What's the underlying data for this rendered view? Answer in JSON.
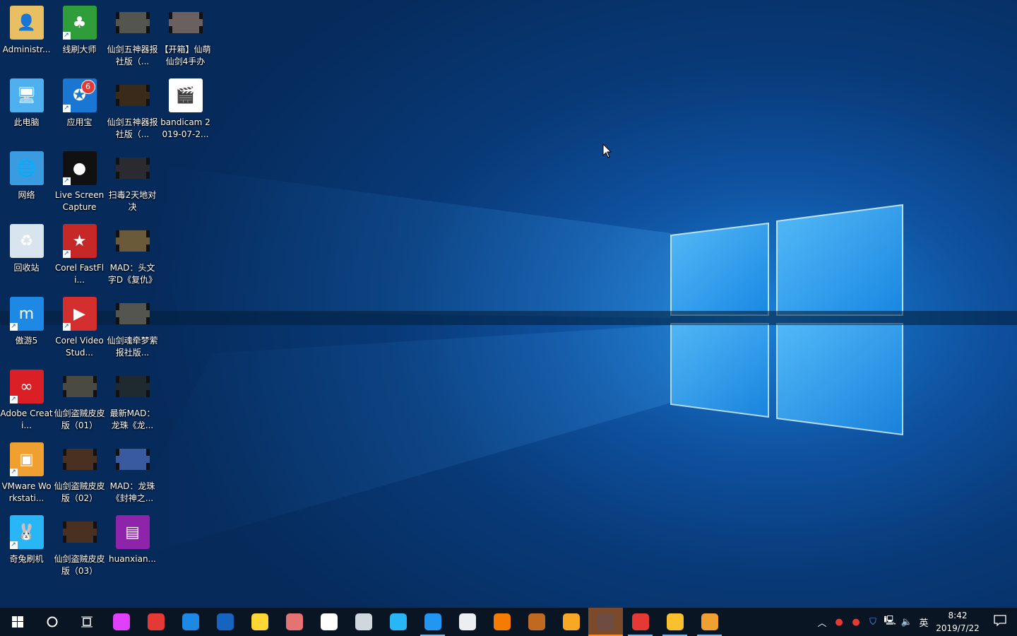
{
  "desktop": {
    "icons": [
      {
        "label": "Administr...",
        "icon": "user-folder-icon",
        "color": "#e8c063",
        "col": 0,
        "row": 0,
        "shortcut": false
      },
      {
        "label": "此电脑",
        "icon": "computer-icon",
        "color": "#4fb0f0",
        "col": 0,
        "row": 1,
        "shortcut": false
      },
      {
        "label": "网络",
        "icon": "network-icon",
        "color": "#3b9be0",
        "col": 0,
        "row": 2,
        "shortcut": false
      },
      {
        "label": "回收站",
        "icon": "recycle-bin-icon",
        "color": "#d8e4ee",
        "col": 0,
        "row": 3,
        "shortcut": false
      },
      {
        "label": "傲游5",
        "icon": "maxthon-icon",
        "color": "#1e88e5",
        "col": 0,
        "row": 4,
        "shortcut": true
      },
      {
        "label": "Adobe Creati...",
        "icon": "adobe-cc-icon",
        "color": "#da1f26",
        "col": 0,
        "row": 5,
        "shortcut": true
      },
      {
        "label": "VMware Workstati...",
        "icon": "vmware-icon",
        "color": "#f0a030",
        "col": 0,
        "row": 6,
        "shortcut": true
      },
      {
        "label": "奇兔刷机",
        "icon": "rabbit-icon",
        "color": "#29b6f6",
        "col": 0,
        "row": 7,
        "shortcut": true
      },
      {
        "label": "线刷大师",
        "icon": "flash-master-icon",
        "color": "#2e9d3a",
        "col": 1,
        "row": 0,
        "shortcut": true
      },
      {
        "label": "应用宝",
        "icon": "app-store-icon",
        "color": "#1976d2",
        "col": 1,
        "row": 1,
        "shortcut": true,
        "badge": "6"
      },
      {
        "label": "Live Screen Capture",
        "icon": "record-icon",
        "color": "#111111",
        "col": 1,
        "row": 2,
        "shortcut": true
      },
      {
        "label": "Corel FastFli...",
        "icon": "corel-fastflick-icon",
        "color": "#c62828",
        "col": 1,
        "row": 3,
        "shortcut": true
      },
      {
        "label": "Corel VideoStud...",
        "icon": "corel-videostudio-icon",
        "color": "#d32f2f",
        "col": 1,
        "row": 4,
        "shortcut": true
      },
      {
        "label": "仙剑盗贼皮皮版（01）",
        "icon": "video-file-icon",
        "color": "#4a4a42",
        "col": 1,
        "row": 5,
        "shortcut": false
      },
      {
        "label": "仙剑盗贼皮皮版（02）",
        "icon": "video-file-icon",
        "color": "#4a3020",
        "col": 1,
        "row": 6,
        "shortcut": false
      },
      {
        "label": "仙剑盗贼皮皮版（03）",
        "icon": "video-file-icon",
        "color": "#4a3020",
        "col": 1,
        "row": 7,
        "shortcut": false
      },
      {
        "label": "仙剑五神器报社版（...",
        "icon": "video-file-icon",
        "color": "#555550",
        "col": 2,
        "row": 0,
        "shortcut": false
      },
      {
        "label": "仙剑五神器报社版（...",
        "icon": "video-file-icon",
        "color": "#3a2a1a",
        "col": 2,
        "row": 1,
        "shortcut": false
      },
      {
        "label": "扫毒2天地对决",
        "icon": "video-file-icon",
        "color": "#2a2a30",
        "col": 2,
        "row": 2,
        "shortcut": false
      },
      {
        "label": "MAD：头文字D《复仇》",
        "icon": "video-file-icon",
        "color": "#6a5a3a",
        "col": 2,
        "row": 3,
        "shortcut": false
      },
      {
        "label": "仙剑魂牵梦萦报社版...",
        "icon": "video-file-icon",
        "color": "#555550",
        "col": 2,
        "row": 4,
        "shortcut": false
      },
      {
        "label": "最新MAD：龙珠《龙...",
        "icon": "video-file-icon",
        "color": "#1e2a30",
        "col": 2,
        "row": 5,
        "shortcut": false
      },
      {
        "label": "MAD：龙珠《封神之...",
        "icon": "video-file-icon",
        "color": "#3a5aa0",
        "col": 2,
        "row": 6,
        "shortcut": false
      },
      {
        "label": "huanxian...",
        "icon": "winrar-archive-icon",
        "color": "#8e24aa",
        "col": 2,
        "row": 7,
        "shortcut": false
      },
      {
        "label": "【开箱】仙萌仙剑4手办",
        "icon": "video-file-icon",
        "color": "#6a6060",
        "col": 3,
        "row": 0,
        "shortcut": false
      },
      {
        "label": "bandicam 2019-07-2...",
        "icon": "video-clip-file-icon",
        "color": "#1e88e5",
        "col": 3,
        "row": 1,
        "shortcut": false
      }
    ]
  },
  "taskbar": {
    "start_icon": "windows-start-icon",
    "search_icon": "cortana-circle-icon",
    "task_view_icon": "task-view-icon",
    "apps": [
      {
        "icon": "petal-app-icon",
        "color": "#e040fb",
        "state": ""
      },
      {
        "icon": "qq-penguin-icon",
        "color": "#e53935",
        "state": ""
      },
      {
        "icon": "swift-bird-icon",
        "color": "#1e88e5",
        "state": ""
      },
      {
        "icon": "video-player-icon",
        "color": "#1565c0",
        "state": ""
      },
      {
        "icon": "qq-music-icon",
        "color": "#fdd835",
        "state": ""
      },
      {
        "icon": "box-app-icon",
        "color": "#e57373",
        "state": ""
      },
      {
        "icon": "baidu-netdisk-icon",
        "color": "#ffffff",
        "state": ""
      },
      {
        "icon": "cat-app-icon",
        "color": "#cfd8dc",
        "state": ""
      },
      {
        "icon": "globe-app-icon",
        "color": "#29b6f6",
        "state": ""
      },
      {
        "icon": "qq-browser-icon",
        "color": "#2196f3",
        "state": "running"
      },
      {
        "icon": "dragon-app-icon",
        "color": "#eceff1",
        "state": ""
      },
      {
        "icon": "game-knight-icon",
        "color": "#f57c00",
        "state": ""
      },
      {
        "icon": "game-warrior-icon",
        "color": "#bf6a20",
        "state": ""
      },
      {
        "icon": "raccoon-app-icon",
        "color": "#f9a825",
        "state": ""
      },
      {
        "icon": "game-hero-icon",
        "color": "#6d4c41",
        "state": "active"
      },
      {
        "icon": "record-app-icon",
        "color": "#e53935",
        "state": "running"
      },
      {
        "icon": "file-explorer-icon",
        "color": "#fbc02d",
        "state": "running"
      },
      {
        "icon": "vmware-taskbar-icon",
        "color": "#f0a030",
        "state": "running"
      }
    ],
    "tray": {
      "show_hidden_icon": "chevron-up-icon",
      "icons": [
        "qq-penguin-icon",
        "qq-penguin-icon",
        "shield-icon",
        "network-icon",
        "volume-icon"
      ],
      "ime": "英",
      "time": "8:42",
      "date": "2019/7/22",
      "notification_icon": "action-center-icon"
    }
  },
  "colors": {
    "taskbar_bg": "#0a1524",
    "accent": "#76b9ed",
    "active": "#ff8c1a"
  }
}
